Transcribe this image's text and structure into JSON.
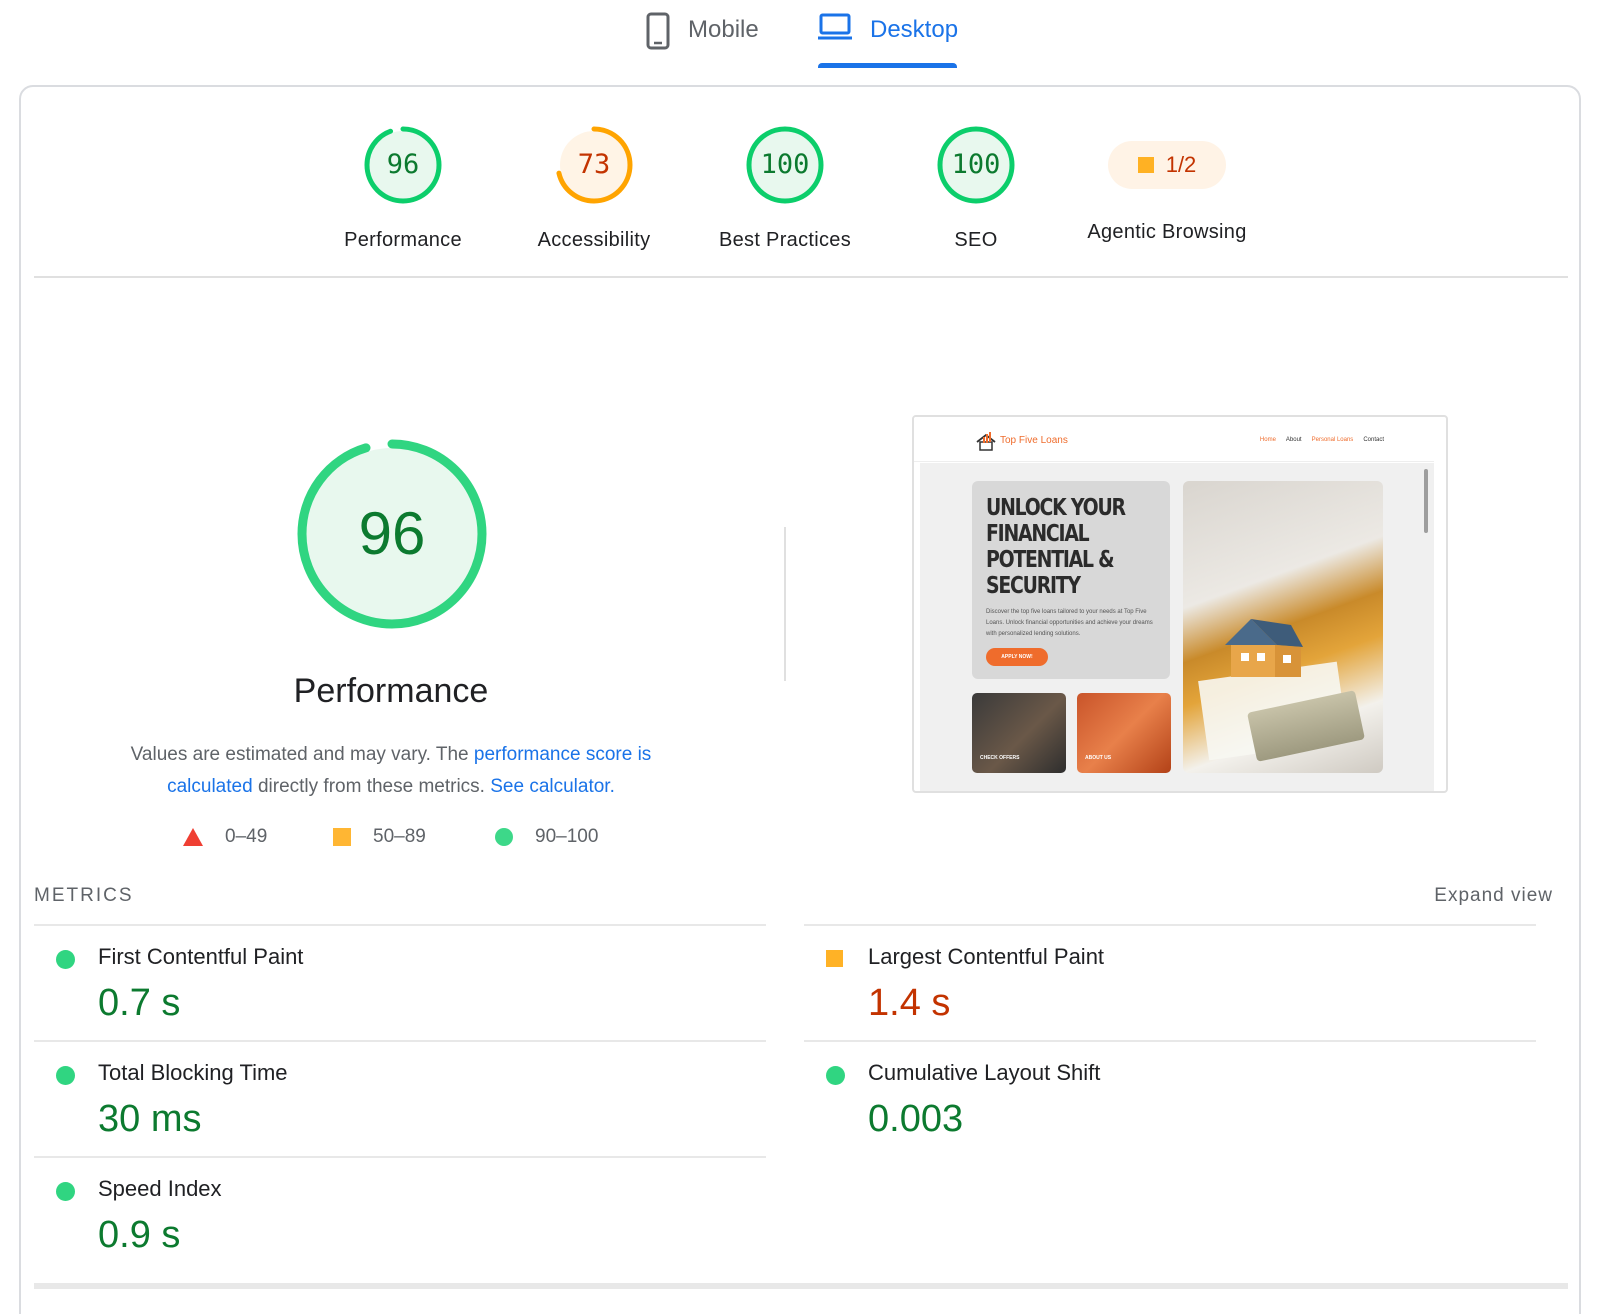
{
  "tabs": {
    "mobile": {
      "label": "Mobile",
      "icon": "phone-icon"
    },
    "desktop": {
      "label": "Desktop",
      "icon": "laptop-icon",
      "selected": true
    }
  },
  "colors": {
    "accent": "#1a73e8",
    "pass": "#0cce6b",
    "average": "#ffa400",
    "fail": "#ff4e42",
    "pass_text": "#0c7a2f",
    "average_text": "#c33300"
  },
  "gauges": [
    {
      "label": "Performance",
      "score": "96",
      "rating": "pass",
      "fraction": 0.96
    },
    {
      "label": "Accessibility",
      "score": "73",
      "rating": "average",
      "fraction": 0.73
    },
    {
      "label": "Best Practices",
      "score": "100",
      "rating": "pass",
      "fraction": 1.0
    },
    {
      "label": "SEO",
      "score": "100",
      "rating": "pass",
      "fraction": 1.0
    }
  ],
  "agentic": {
    "label": "Agentic Browsing",
    "value": "1/2"
  },
  "summary": {
    "score": "96",
    "fraction": 0.96,
    "title": "Performance",
    "note_prefix": "Values are estimated and may vary. The ",
    "note_link1": "performance score is calculated",
    "note_middle": " directly from these metrics. ",
    "note_link2": "See calculator."
  },
  "legend": [
    {
      "shape": "triangle",
      "range": "0–49"
    },
    {
      "shape": "square",
      "range": "50–89"
    },
    {
      "shape": "circle",
      "range": "90–100"
    }
  ],
  "screenshot": {
    "logo_text": "Top Five Loans",
    "nav": [
      "Home",
      "About",
      "Personal Loans",
      "Contact"
    ],
    "hero_title": "UNLOCK YOUR FINANCIAL POTENTIAL & SECURITY",
    "hero_text": "Discover the top five loans tailored to your needs at Top Five Loans. Unlock financial opportunities and achieve your dreams with personalized lending solutions.",
    "hero_button": "APPLY NOW!",
    "tile_a": "CHECK OFFERS",
    "tile_b": "ABOUT US"
  },
  "metrics": {
    "header": "METRICS",
    "expand": "Expand view",
    "items": {
      "fcp": {
        "label": "First Contentful Paint",
        "value": "0.7 s",
        "rating": "pass"
      },
      "lcp": {
        "label": "Largest Contentful Paint",
        "value": "1.4 s",
        "rating": "average"
      },
      "tbt": {
        "label": "Total Blocking Time",
        "value": "30 ms",
        "rating": "pass"
      },
      "cls": {
        "label": "Cumulative Layout Shift",
        "value": "0.003",
        "rating": "pass"
      },
      "si": {
        "label": "Speed Index",
        "value": "0.9 s",
        "rating": "pass"
      }
    }
  }
}
